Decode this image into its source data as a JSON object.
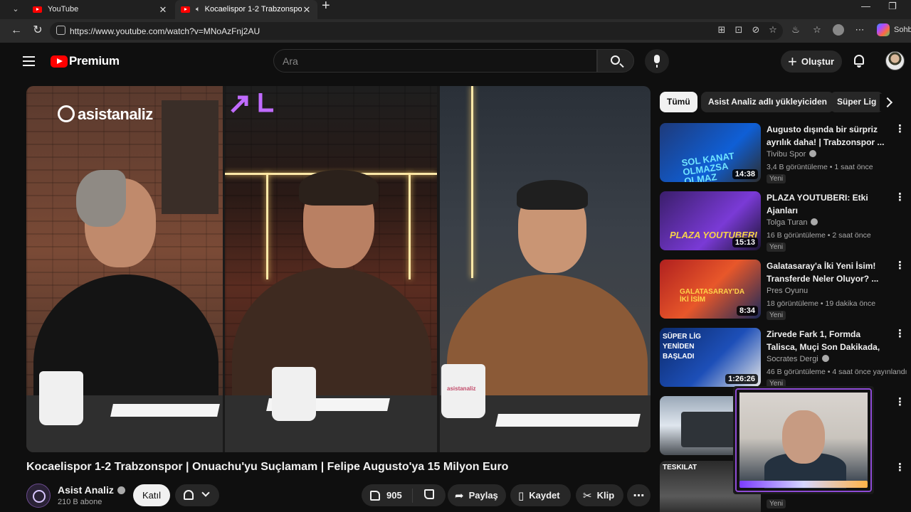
{
  "browser": {
    "tabs": [
      {
        "title": "YouTube",
        "active": false
      },
      {
        "title": "Kocaelispor 1-2 Trabzonspor | Onuachu'yu Suçlamam | Felipe Augusto'ya 15 Milyon Euro",
        "active": true
      }
    ],
    "url": "https://www.youtube.com/watch?v=MNoAzFnj2AU",
    "sidebar_label": "Sohb"
  },
  "header": {
    "logo_text": "Premium",
    "search_placeholder": "Ara",
    "create_label": "Oluştur"
  },
  "video": {
    "overlay_logo": "asistanaliz",
    "title": "Kocaelispor 1-2 Trabzonspor | Onuachu'yu Suçlamam | Felipe Augusto'ya 15 Milyon Euro",
    "channel": "Asist Analiz",
    "subscribers": "210 B abone",
    "join_label": "Katıl",
    "likes": "905",
    "share_label": "Paylaş",
    "save_label": "Kaydet",
    "clip_label": "Klip",
    "more_label": "⋯",
    "mug_text": "asistanaliz"
  },
  "chips": [
    "Tümü",
    "Asist Analiz adlı yükleyiciden",
    "Süper Lig"
  ],
  "recommendations": [
    {
      "title": "Augusto dışında bir sürpriz ayrılık daha! | Trabzonspor ...",
      "channel": "Tivibu Spor",
      "meta": "3,4 B görüntüleme • 1 saat önce",
      "badge": "Yeni",
      "duration": "14:38",
      "thumb_text": "SOL KANAT OLMAZSA OLMAZ"
    },
    {
      "title": "PLAZA YOUTUBERI: Etki Ajanları",
      "channel": "Tolga Turan",
      "meta": "16 B görüntüleme • 2 saat önce",
      "badge": "Yeni",
      "duration": "15:13",
      "thumb_text": "PLAZA YOUTUBERI"
    },
    {
      "title": "Galatasaray'a İki Yeni İsim! Transferde Neler Oluyor? ...",
      "channel": "Pres Oyunu",
      "meta": "18 görüntüleme • 19 dakika önce",
      "badge": "Yeni",
      "duration": "8:34",
      "thumb_text": "GALATASARAY'DA İKİ İSİM"
    },
    {
      "title": "Zirvede Fark 1, Formda Talisca, Muçi Son Dakikada, Kante | ...",
      "channel": "Socrates Dergi",
      "meta": "46 B görüntüleme • 4 saat önce yayınlandı",
      "badge": "Yeni",
      "duration": "1:26:26",
      "thumb_text": "SÜPER LİG YENİDEN BAŞLADI"
    },
    {
      "title": "",
      "channel": "",
      "meta": "",
      "badge": "",
      "duration": "",
      "thumb_text": ""
    },
    {
      "title": "",
      "channel": "",
      "meta": "",
      "badge": "Yeni",
      "duration": "",
      "thumb_text": "TESKILAT"
    }
  ]
}
